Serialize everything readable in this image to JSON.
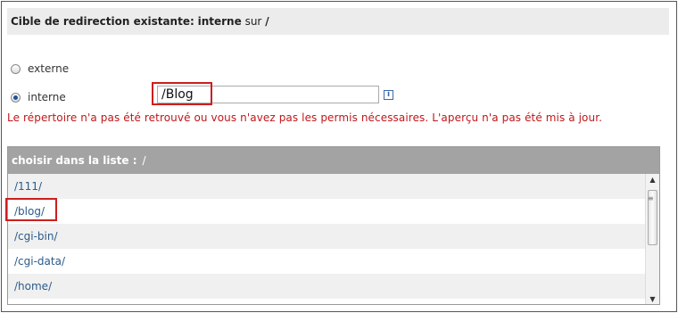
{
  "header": {
    "label": "Cible de redirection existante:",
    "target_type": "interne",
    "connector": "sur",
    "path": "/"
  },
  "radios": [
    {
      "label": "externe",
      "checked": false
    },
    {
      "label": "interne",
      "checked": true
    }
  ],
  "input": {
    "value": "/Blog"
  },
  "info_icon": "i",
  "error": "Le répertoire n'a pas été retrouvé ou vous n'avez pas les permis nécessaires. L'aperçu n'a pas été mis à jour.",
  "list": {
    "header_label": "choisir dans la liste :",
    "header_path": "/",
    "items": [
      "/111/",
      "/blog/",
      "/cgi-bin/",
      "/cgi-data/",
      "/home/"
    ]
  },
  "scrollbar": {
    "up": "▲",
    "down": "▼",
    "grip": "≡"
  }
}
